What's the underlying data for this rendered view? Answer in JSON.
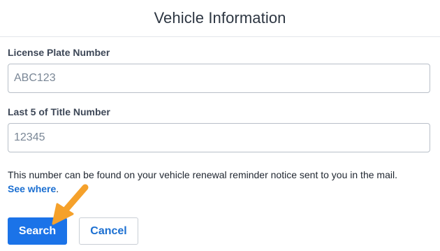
{
  "header": {
    "title": "Vehicle Information"
  },
  "form": {
    "license_plate": {
      "label": "License Plate Number",
      "placeholder": "ABC123",
      "value": ""
    },
    "title_number": {
      "label": "Last 5 of Title Number",
      "placeholder": "12345",
      "value": ""
    },
    "help_text": "This number can be found on your vehicle renewal reminder notice sent to you in the mail.",
    "help_link": "See where",
    "help_suffix": "."
  },
  "actions": {
    "search_label": "Search",
    "cancel_label": "Cancel"
  },
  "colors": {
    "primary": "#1b73e8",
    "link": "#1b6fd1",
    "annotation_arrow": "#f5a12b"
  },
  "icons": {
    "annotation": "orange-arrow-icon"
  }
}
